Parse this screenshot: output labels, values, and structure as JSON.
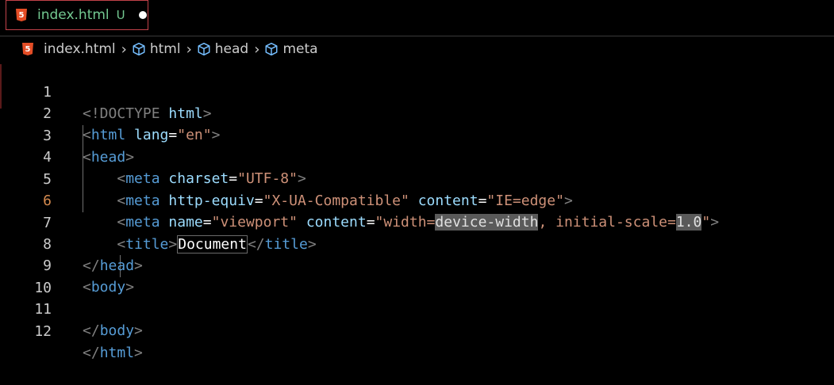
{
  "tab": {
    "label": "index.html",
    "status": "U"
  },
  "breadcrumb": {
    "file": "index.html",
    "items": [
      "html",
      "head",
      "meta"
    ]
  },
  "editor": {
    "active_line": 6,
    "lines": [
      {
        "n": "1"
      },
      {
        "n": "2"
      },
      {
        "n": "3"
      },
      {
        "n": "4"
      },
      {
        "n": "5"
      },
      {
        "n": "6"
      },
      {
        "n": "7"
      },
      {
        "n": "8"
      },
      {
        "n": "9"
      },
      {
        "n": "10"
      },
      {
        "n": "11"
      },
      {
        "n": "12"
      }
    ],
    "tokens": {
      "doctype": "<!DOCTYPE",
      "html": "html",
      "lang_attr": "lang",
      "lang_val": "\"en\"",
      "head": "head",
      "meta": "meta",
      "charset_attr": "charset",
      "charset_val": "\"UTF-8\"",
      "http_equiv_attr": "http-equiv",
      "http_equiv_val": "\"X-UA-Compatible\"",
      "content_attr": "content",
      "ie_edge_val": "\"IE=edge\"",
      "name_attr": "name",
      "viewport_val": "\"viewport\"",
      "vp_content_a": "\"width=",
      "vp_content_b": "device-width",
      "vp_content_c": ", initial-scale=",
      "vp_content_d": "1.0",
      "vp_content_e": "\"",
      "title": "title",
      "title_text": "Document",
      "body": "body"
    }
  },
  "colors": {
    "tag": "#569cd6",
    "attribute": "#9cdcfe",
    "string": "#ce9178",
    "punctuation": "#808080",
    "modified_file": "#73c991",
    "tab_border": "#c2424a",
    "html5_icon": "#e44d26"
  }
}
